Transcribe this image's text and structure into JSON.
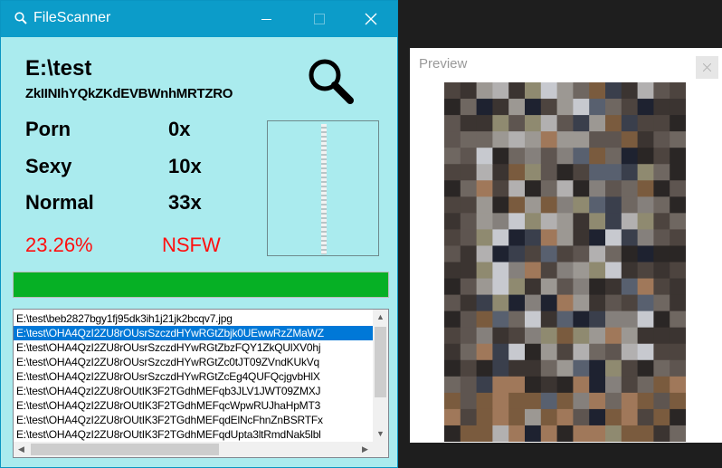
{
  "window": {
    "title": "FileScanner"
  },
  "scan": {
    "path": "E:\\test",
    "current_file": "ZkIINIhYQkZKdEVBWnhMRTZRO"
  },
  "results": [
    {
      "label": "Porn",
      "value": "0x"
    },
    {
      "label": "Sexy",
      "value": "10x"
    },
    {
      "label": "Normal",
      "value": "33x"
    }
  ],
  "summary": {
    "percent": "23.26%",
    "verdict": "NSFW"
  },
  "progress": {
    "fraction": 1.0
  },
  "files": {
    "selected_index": 1,
    "items": [
      "E:\\test\\beb2827bgy1fj95dk3ih1j21jk2bcqv7.jpg",
      "E:\\test\\OHA4QzI2ZU8rOUsrSzczdHYwRGtZbjk0UEwwRzZMaWZ",
      "E:\\test\\OHA4QzI2ZU8rOUsrSzczdHYwRGtZbzFQY1ZkQUlXV0hj",
      "E:\\test\\OHA4QzI2ZU8rOUsrSzczdHYwRGtZc0tJT09ZVndKUkVq",
      "E:\\test\\OHA4QzI2ZU8rOUsrSzczdHYwRGtZcEg4QUFQcjgvbHlX",
      "E:\\test\\OHA4QzI2ZU8rOUtIK3F2TGdhMEFqb3JLV1JWT09ZMXJ",
      "E:\\test\\OHA4QzI2ZU8rOUtIK3F2TGdhMEFqcWpwRUJhaHpMT3",
      "E:\\test\\OHA4QzI2ZU8rOUtIK3F2TGdhMEFqdElNcFhnZnBSRTFx",
      "E:\\test\\OHA4QzI2ZU8rOUtIK3F2TGdhMEFqdUpta3ltRmdNak5lbl"
    ]
  },
  "preview": {
    "title": "Preview"
  },
  "colors": {
    "title_bar": "#0c9cc9",
    "window_bg": "#aaebee",
    "alert": "#ff0f0f",
    "progress": "#06b025",
    "selection": "#0078d7"
  },
  "icons": {
    "app": "search-icon",
    "scan_button": "magnifier-icon",
    "close": "close-icon"
  }
}
